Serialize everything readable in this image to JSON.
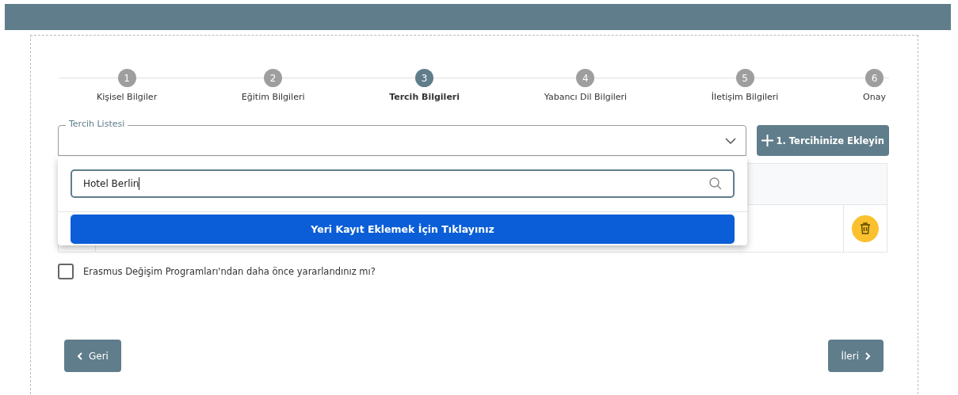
{
  "steps": [
    {
      "number": "1",
      "label": "Kişisel Bilgiler",
      "selected": false
    },
    {
      "number": "2",
      "label": "Eğitim Bilgileri",
      "selected": false
    },
    {
      "number": "3",
      "label": "Tercih Bilgileri",
      "selected": true
    },
    {
      "number": "4",
      "label": "Yabancı Dil Bilgileri",
      "selected": false
    },
    {
      "number": "5",
      "label": "İletişim Bilgileri",
      "selected": false
    },
    {
      "number": "6",
      "label": "Onay",
      "selected": false
    }
  ],
  "preference_select": {
    "label": "Tercih Listesi",
    "expanded": true
  },
  "add_button": {
    "label": "1. Tercihinize Ekleyin"
  },
  "dropdown": {
    "search_value": "Hotel Berlin",
    "action_button": "Yeri Kayıt Eklemek İçin Tıklayınız"
  },
  "erasmus_checkbox": {
    "label": "Erasmus Değişim Programları'ndan daha önce yararlandınız mı?",
    "checked": false
  },
  "back_button": {
    "label": "Geri"
  },
  "next_button": {
    "label": "İleri"
  }
}
